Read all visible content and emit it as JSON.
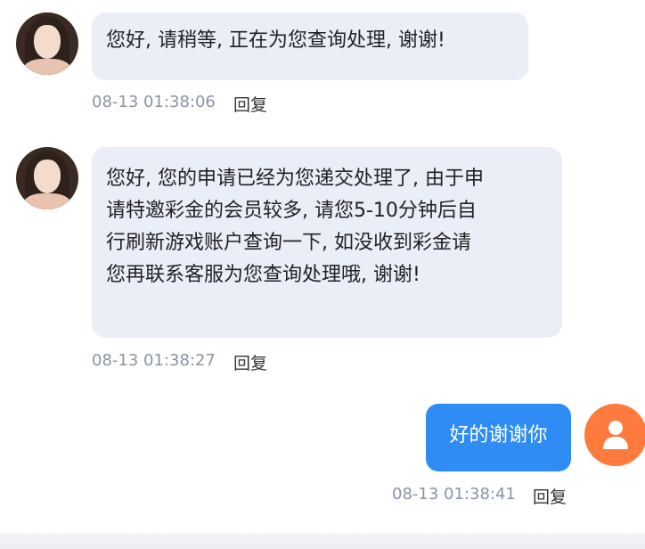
{
  "messages": [
    {
      "sender": "agent",
      "text": "您好, 请稍等, 正在为您查询处理, 谢谢!",
      "time": "08-13 01:38:06",
      "reply_label": "回复"
    },
    {
      "sender": "agent",
      "lines": [
        "您好, 您的申请已经为您递交处理了, 由于申",
        "请特邀彩金的会员较多, 请您5-10分钟后自",
        "行刷新游戏账户查询一下, 如没收到彩金请",
        "您再联系客服为您查询处理哦, 谢谢!"
      ],
      "time": "08-13 01:38:27",
      "reply_label": "回复"
    },
    {
      "sender": "user",
      "text": "好的谢谢你",
      "time": "08-13 01:38:41",
      "reply_label": "回复"
    }
  ],
  "colors": {
    "agent_bubble": "#e9eef7",
    "user_bubble": "#2f8cf4",
    "user_avatar": "#ff7a3d",
    "timestamp": "#8a94a6"
  },
  "icons": {
    "agent_avatar": "agent-photo-avatar",
    "user_avatar": "user-silhouette-icon"
  }
}
